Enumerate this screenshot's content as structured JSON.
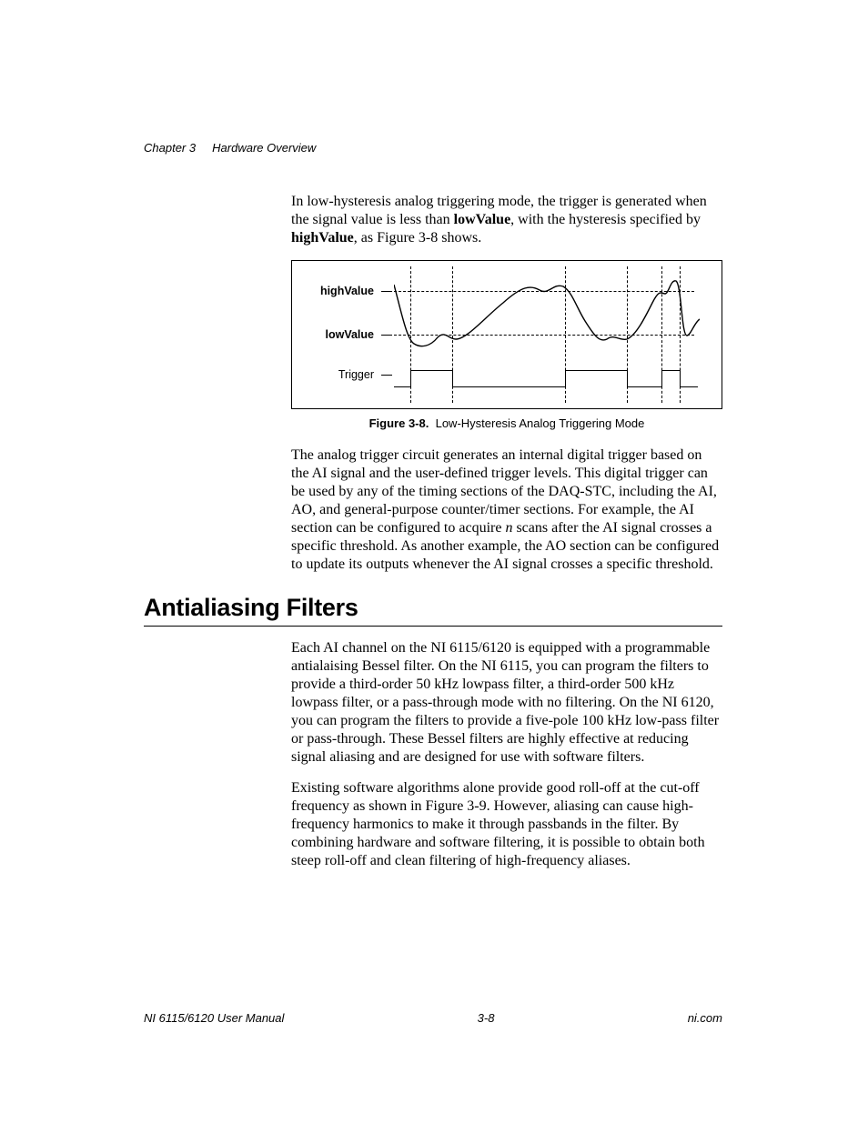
{
  "header": {
    "chapter": "Chapter 3",
    "title": "Hardware Overview"
  },
  "para1": {
    "pre": "In low-hysteresis analog triggering mode, the trigger is generated when the signal value is less than ",
    "b1": "lowValue",
    "mid": ", with the hysteresis specified by ",
    "b2": "highValue",
    "post": ", as Figure 3-8 shows."
  },
  "figure": {
    "labels": {
      "high": "highValue",
      "low": "lowValue",
      "trigger": "Trigger"
    },
    "caption_num": "Figure 3-8.",
    "caption_text": "Low-Hysteresis Analog Triggering Mode"
  },
  "para2": {
    "pre": "The analog trigger circuit generates an internal digital trigger based on the AI signal and the user-defined trigger levels. This digital trigger can be used by any of the timing sections of the DAQ-STC, including the AI, AO, and general-purpose counter/timer sections. For example, the AI section can be configured to acquire ",
    "i1": "n",
    "post": " scans after the AI signal crosses a specific threshold. As another example, the AO section can be configured to update its outputs whenever the AI signal crosses a specific threshold."
  },
  "section_heading": "Antialiasing Filters",
  "para3": "Each AI channel on the NI 6115/6120 is equipped with a programmable antialaising Bessel filter. On the NI 6115, you can program the filters to provide a third-order 50 kHz lowpass filter, a third-order 500 kHz lowpass filter, or a pass-through mode with no filtering. On the NI 6120, you can program the filters to provide a five-pole 100 kHz low-pass filter or pass-through. These Bessel filters are highly effective at reducing signal aliasing and are designed for use with software filters.",
  "para4": "Existing software algorithms alone provide good roll-off at the cut-off frequency as shown in Figure 3-9. However, aliasing can cause high-frequency harmonics to make it through passbands in the filter. By combining hardware and software filtering, it is possible to obtain both steep roll-off and clean filtering of high-frequency aliases.",
  "footer": {
    "left": "NI 6115/6120 User Manual",
    "center": "3-8",
    "right": "ni.com"
  }
}
